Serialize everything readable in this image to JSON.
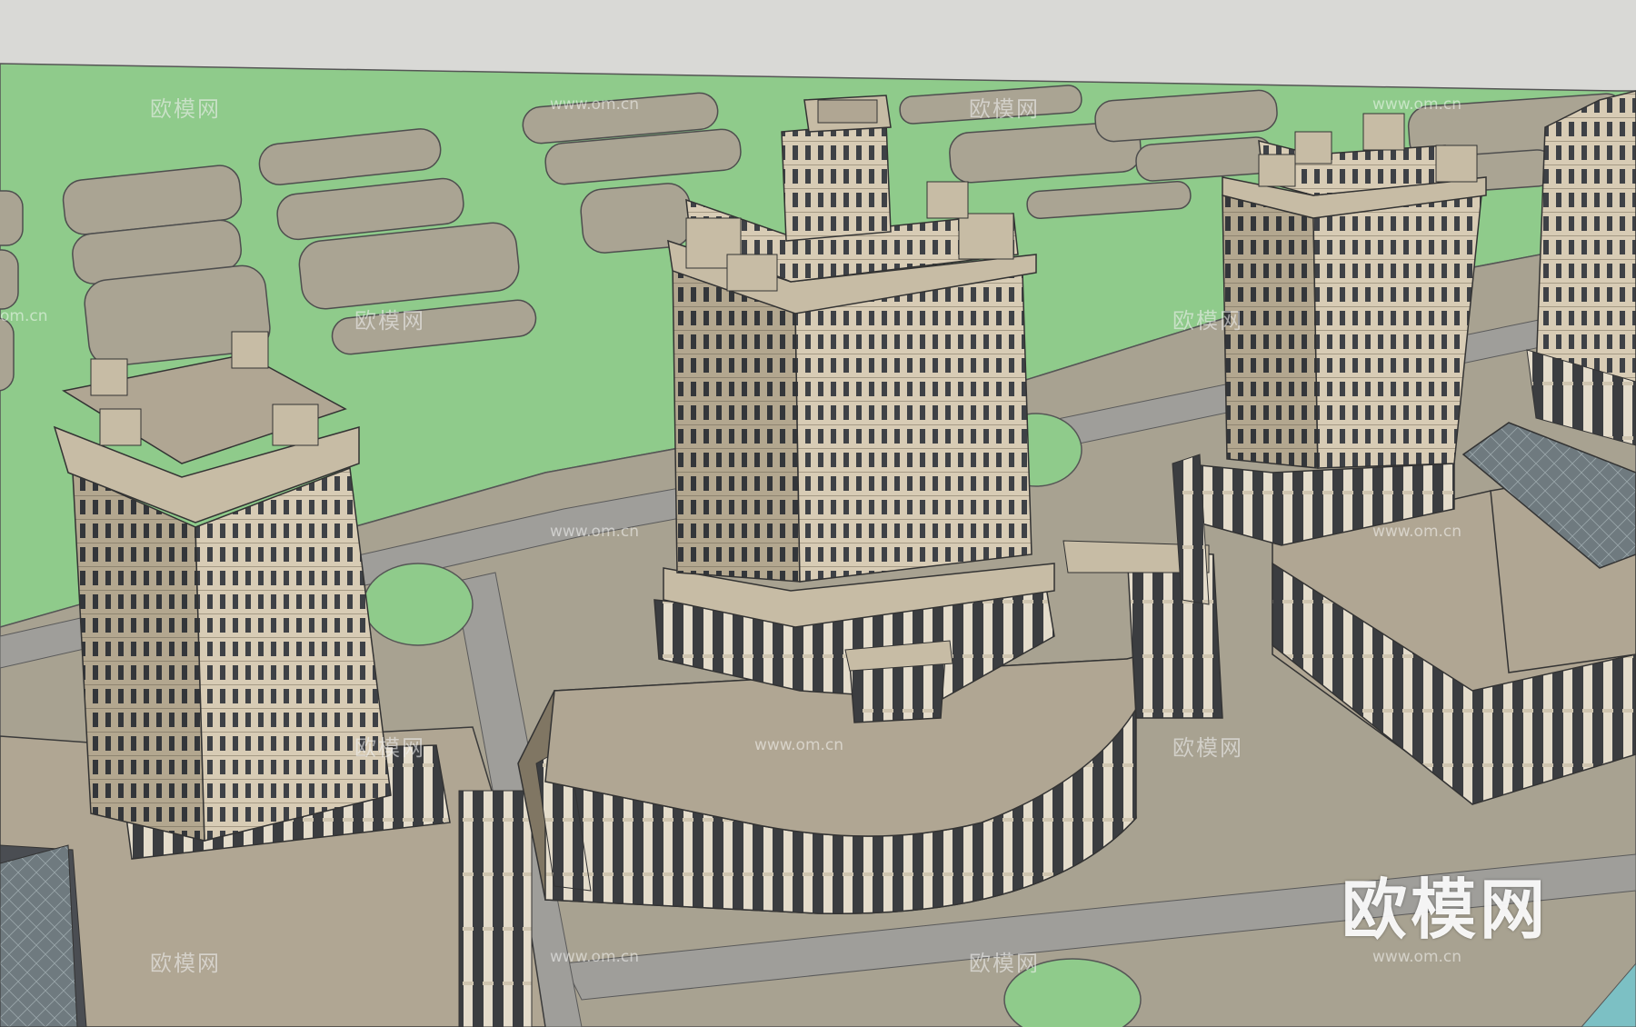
{
  "watermark": {
    "logo_text": "欧模网",
    "tile_text": "欧模网",
    "url_text": "www.om.cn",
    "partial_url_text": "om.cn"
  },
  "colors": {
    "sky": "#d9d9d6",
    "grass": "#8fcb8b",
    "paving": "#a8a291",
    "road": "#9f9e9a",
    "facade": "#d8ccb5",
    "facade_shade": "#b3a78f",
    "roof": "#b0a693",
    "glass_band": "#3e4146",
    "water": "#7cc0c4"
  }
}
